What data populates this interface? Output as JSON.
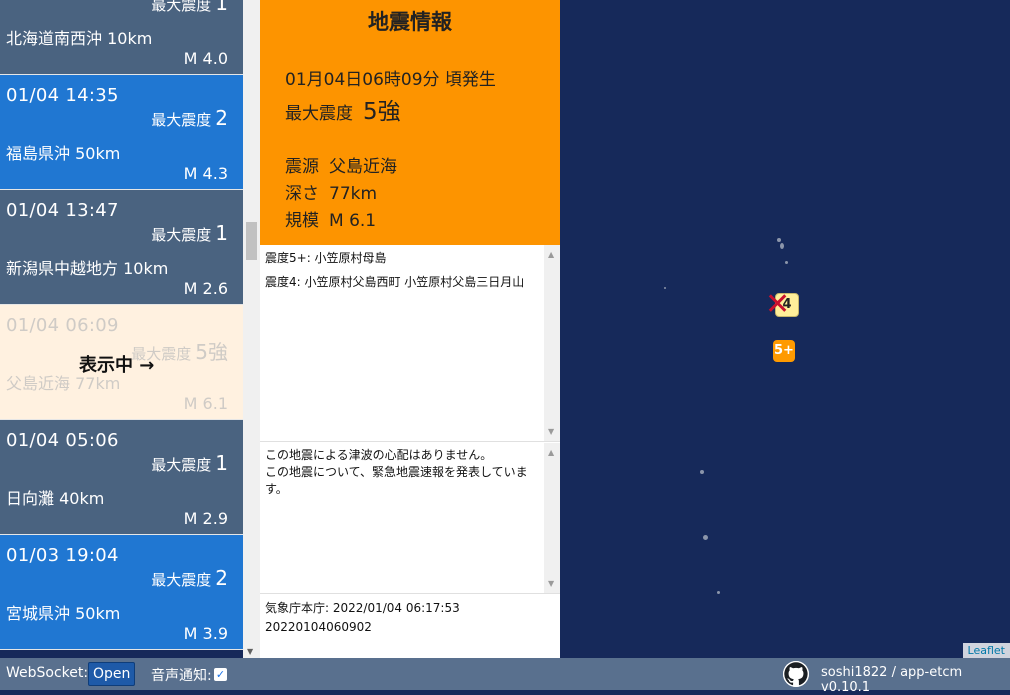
{
  "quakes": [
    {
      "time": "",
      "intensity_label": "最大震度",
      "intensity": "1",
      "location": "北海道南西沖 10km",
      "magnitude": "M 4.0",
      "style": "slate"
    },
    {
      "time": "01/04 14:35",
      "intensity_label": "最大震度",
      "intensity": "2",
      "location": "福島県沖 50km",
      "magnitude": "M 4.3",
      "style": "blue"
    },
    {
      "time": "01/04 13:47",
      "intensity_label": "最大震度",
      "intensity": "1",
      "location": "新潟県中越地方 10km",
      "magnitude": "M 2.6",
      "style": "slate"
    },
    {
      "time": "01/04 06:09",
      "intensity_label": "最大震度",
      "intensity": "5強",
      "location": "父島近海 77km",
      "magnitude": "M 6.1",
      "style": "active"
    },
    {
      "time": "01/04 05:06",
      "intensity_label": "最大震度",
      "intensity": "1",
      "location": "日向灘 40km",
      "magnitude": "M 2.9",
      "style": "slate"
    },
    {
      "time": "01/03 19:04",
      "intensity_label": "最大震度",
      "intensity": "2",
      "location": "宮城県沖 50km",
      "magnitude": "M 3.9",
      "style": "blue"
    }
  ],
  "overlay_text": "表示中 →",
  "detail": {
    "title": "地震情報",
    "occurred": "01月04日06時09分 頃発生",
    "max_intensity_label": "最大震度",
    "max_intensity": "5強",
    "epicenter_label": "震源",
    "epicenter": "父島近海",
    "depth_label": "深さ",
    "depth": "77km",
    "scale_label": "規模",
    "scale": "M 6.1",
    "intensity_lines": [
      "震度5+: 小笠原村母島",
      "震度4: 小笠原村父島西町 小笠原村父島三日月山"
    ],
    "comments": [
      "この地震による津波の心配はありません。",
      "この地震について、緊急地震速報を発表しています。"
    ],
    "issuer": "気象庁本庁: 2022/01/04 06:17:53",
    "event_id": "20220104060902"
  },
  "map": {
    "marker_4": "4",
    "marker_5": "5+",
    "epicenter_symbol": "✕",
    "attribution": "Leaflet"
  },
  "bar": {
    "websocket_label": "WebSocket:",
    "websocket_status": "Open",
    "sound_label": "音声通知:",
    "sound_checked": "✓",
    "repo": "soshi1822 / app-etcm v0.10.1"
  },
  "colors": {
    "slate": "#4a6380",
    "blue": "#2077d2",
    "orange": "#fd9400",
    "map_sea": "#16295a",
    "bar": "#59708e"
  }
}
